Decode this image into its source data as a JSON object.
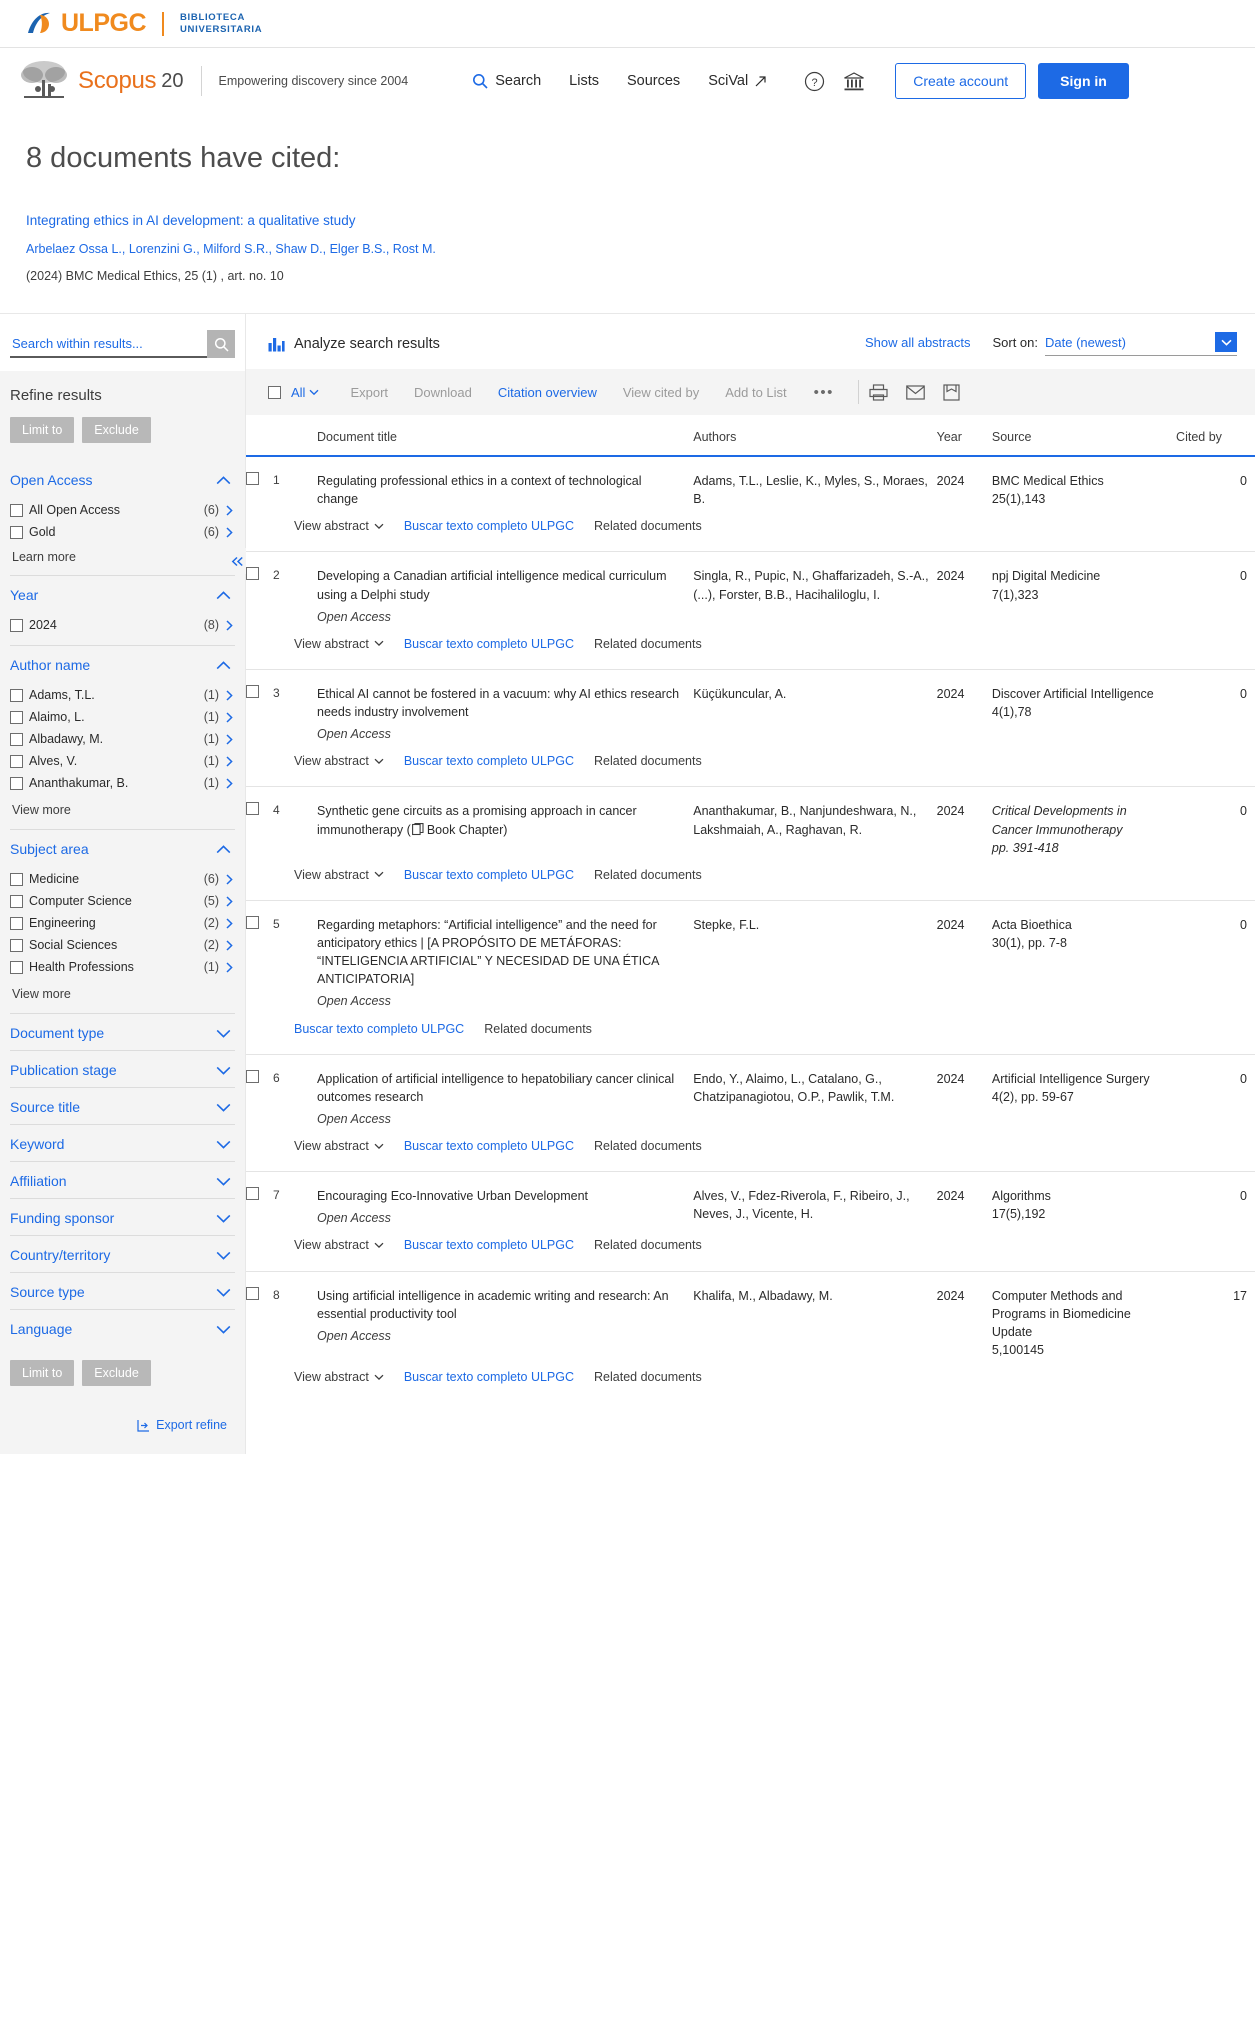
{
  "ulpgc": {
    "name": "ULPGC",
    "sub_line1": "BIBLIOTECA",
    "sub_line2": "UNIVERSITARIA"
  },
  "scopus_nav": {
    "brand": "Scopus",
    "brand_suffix": "20",
    "tagline": "Empowering discovery since 2004",
    "links": [
      {
        "label": "Search",
        "icon": "search-icon"
      },
      {
        "label": "Lists",
        "icon": null
      },
      {
        "label": "Sources",
        "icon": null
      },
      {
        "label": "SciVal",
        "icon": "external-link-icon"
      }
    ],
    "help_icon": "question-circle-icon",
    "institution_icon": "bank-icon",
    "create_account": "Create account",
    "sign_in": "Sign in"
  },
  "cited_header": {
    "heading": "8 documents have cited:",
    "title": "Integrating ethics in AI development: a qualitative study",
    "authors": "Arbelaez Ossa L., Lorenzini G., Milford S.R., Shaw D., Elger B.S., Rost M.",
    "source": "(2024) BMC Medical Ethics, 25 (1) , art. no. 10"
  },
  "sidebar": {
    "search_placeholder": "Search within results...",
    "refine_heading": "Refine results",
    "limit_to": "Limit to",
    "exclude": "Exclude",
    "learn_more": "Learn more",
    "view_more": "View more",
    "export_refine": "Export refine",
    "facets": [
      {
        "name": "Open Access",
        "expanded": true,
        "items": [
          {
            "label": "All Open Access",
            "count": "(6)"
          },
          {
            "label": "Gold",
            "count": "(6)"
          }
        ],
        "footer": "learn_more"
      },
      {
        "name": "Year",
        "expanded": true,
        "items": [
          {
            "label": "2024",
            "count": "(8)"
          }
        ]
      },
      {
        "name": "Author name",
        "expanded": true,
        "items": [
          {
            "label": "Adams, T.L.",
            "count": "(1)"
          },
          {
            "label": "Alaimo, L.",
            "count": "(1)"
          },
          {
            "label": "Albadawy, M.",
            "count": "(1)"
          },
          {
            "label": "Alves, V.",
            "count": "(1)"
          },
          {
            "label": "Ananthakumar, B.",
            "count": "(1)"
          }
        ],
        "footer": "view_more"
      },
      {
        "name": "Subject area",
        "expanded": true,
        "items": [
          {
            "label": "Medicine",
            "count": "(6)"
          },
          {
            "label": "Computer Science",
            "count": "(5)"
          },
          {
            "label": "Engineering",
            "count": "(2)"
          },
          {
            "label": "Social Sciences",
            "count": "(2)"
          },
          {
            "label": "Health Professions",
            "count": "(1)"
          }
        ],
        "footer": "view_more"
      },
      {
        "name": "Document type",
        "expanded": false,
        "items": []
      },
      {
        "name": "Publication stage",
        "expanded": false,
        "items": []
      },
      {
        "name": "Source title",
        "expanded": false,
        "items": []
      },
      {
        "name": "Keyword",
        "expanded": false,
        "items": []
      },
      {
        "name": "Affiliation",
        "expanded": false,
        "items": []
      },
      {
        "name": "Funding sponsor",
        "expanded": false,
        "items": []
      },
      {
        "name": "Country/territory",
        "expanded": false,
        "items": []
      },
      {
        "name": "Source type",
        "expanded": false,
        "items": []
      },
      {
        "name": "Language",
        "expanded": false,
        "items": []
      }
    ]
  },
  "results": {
    "analyze_label": "Analyze search results",
    "show_abstracts": "Show all abstracts",
    "sort_label": "Sort on:",
    "sort_value": "Date (newest)",
    "toolbar": {
      "all_label": "All",
      "export": "Export",
      "download": "Download",
      "citation_overview": "Citation overview",
      "view_cited_by": "View cited by",
      "add_to_list": "Add to List",
      "more": "•••",
      "print_icon": "printer-icon",
      "email_icon": "envelope-icon",
      "save_icon": "save-document-icon"
    },
    "columns": {
      "title": "Document title",
      "authors": "Authors",
      "year": "Year",
      "source": "Source",
      "cited_by": "Cited by"
    },
    "row_actions": {
      "view_abstract": "View abstract",
      "full_text": "Buscar texto completo ULPGC",
      "related": "Related documents"
    },
    "rows": [
      {
        "num": "1",
        "title": "Regulating professional ethics in a context of technological change",
        "open_access": false,
        "book_chapter": false,
        "authors": "Adams, T.L., Leslie, K., Myles, S., Moraes, B.",
        "year": "2024",
        "source_lines": [
          "BMC Medical Ethics",
          "25(1),143"
        ],
        "source_italic": false,
        "cited_by": "0",
        "has_abstract": true
      },
      {
        "num": "2",
        "title": "Developing a Canadian artificial intelligence medical curriculum using a Delphi study",
        "open_access": true,
        "book_chapter": false,
        "authors": "Singla, R., Pupic, N., Ghaffarizadeh, S.-A., (...), Forster, B.B., Hacihaliloglu, I.",
        "year": "2024",
        "source_lines": [
          "npj Digital Medicine",
          "7(1),323"
        ],
        "source_italic": false,
        "cited_by": "0",
        "has_abstract": true
      },
      {
        "num": "3",
        "title": "Ethical AI cannot be fostered in a vacuum: why AI ethics research needs industry involvement",
        "open_access": true,
        "book_chapter": false,
        "authors": "Küçükuncular, A.",
        "year": "2024",
        "source_lines": [
          "Discover Artificial Intelligence",
          "4(1),78"
        ],
        "source_italic": false,
        "cited_by": "0",
        "has_abstract": true
      },
      {
        "num": "4",
        "title": "Synthetic gene circuits as a promising approach in cancer immunotherapy (",
        "title_tail": "Book Chapter)",
        "open_access": false,
        "book_chapter": true,
        "authors": "Ananthakumar, B., Nanjundeshwara, N., Lakshmaiah, A., Raghavan, R.",
        "year": "2024",
        "source_lines": [
          "Critical Developments in Cancer Immunotherapy",
          "pp. 391-418"
        ],
        "source_italic": true,
        "cited_by": "0",
        "has_abstract": true
      },
      {
        "num": "5",
        "title": "Regarding metaphors: “Artificial intelligence” and the need for anticipatory ethics | [A PROPÓSITO DE METÁFORAS: “INTELIGENCIA ARTIFICIAL” Y NECESIDAD DE UNA ÉTICA ANTICIPATORIA]",
        "open_access": true,
        "book_chapter": false,
        "authors": "Stepke, F.L.",
        "year": "2024",
        "source_lines": [
          "Acta Bioethica",
          "30(1), pp. 7-8"
        ],
        "source_italic": false,
        "cited_by": "0",
        "has_abstract": false
      },
      {
        "num": "6",
        "title": "Application of artificial intelligence to hepatobiliary cancer clinical outcomes research",
        "open_access": true,
        "book_chapter": false,
        "authors": "Endo, Y., Alaimo, L., Catalano, G., Chatzipanagiotou, O.P., Pawlik, T.M.",
        "year": "2024",
        "source_lines": [
          "Artificial Intelligence Surgery",
          "4(2), pp. 59-67"
        ],
        "source_italic": false,
        "cited_by": "0",
        "has_abstract": true
      },
      {
        "num": "7",
        "title": "Encouraging Eco-Innovative Urban Development",
        "open_access": true,
        "book_chapter": false,
        "authors": "Alves, V., Fdez-Riverola, F., Ribeiro, J., Neves, J., Vicente, H.",
        "year": "2024",
        "source_lines": [
          "Algorithms",
          "17(5),192"
        ],
        "source_italic": false,
        "cited_by": "0",
        "has_abstract": true
      },
      {
        "num": "8",
        "title": "Using artificial intelligence in academic writing and research: An essential productivity tool",
        "open_access": true,
        "book_chapter": false,
        "authors": "Khalifa, M., Albadawy, M.",
        "year": "2024",
        "source_lines": [
          "Computer Methods and Programs in Biomedicine Update",
          "5,100145"
        ],
        "source_italic": false,
        "cited_by": "17",
        "has_abstract": true
      }
    ],
    "open_access_label": "Open Access",
    "book_chapter_label": "Book Chapter"
  },
  "colors": {
    "link": "#1d6ae5",
    "brand_orange": "#e9711c",
    "ulpgc_orange": "#f08a1e",
    "ulpgc_blue": "#1b63b0",
    "sidebar_bg": "#f4f4f4"
  }
}
